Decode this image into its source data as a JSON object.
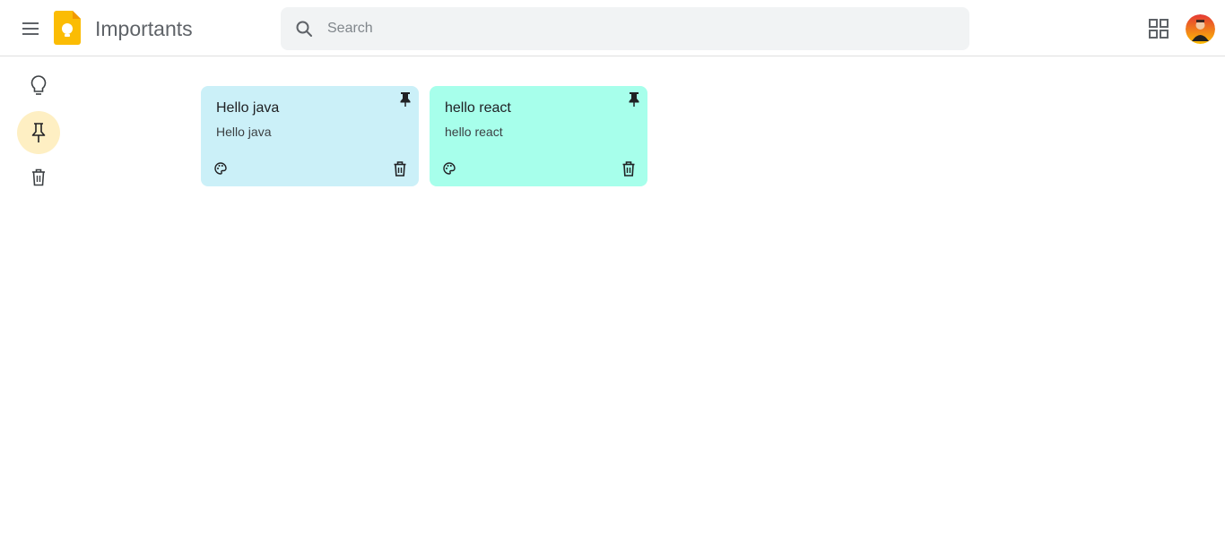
{
  "header": {
    "title": "Importants",
    "menu_icon": "hamburger-menu-icon",
    "logo_icon": "keep-logo-icon",
    "search": {
      "placeholder": "Search",
      "value": "",
      "icon": "search-icon"
    },
    "layout_icon": "grid-view-icon",
    "avatar_icon": "user-avatar"
  },
  "sidebar": {
    "items": [
      {
        "id": "notes",
        "icon": "lightbulb-icon",
        "active": false
      },
      {
        "id": "importants",
        "icon": "pin-icon",
        "active": true
      },
      {
        "id": "trash",
        "icon": "trash-icon",
        "active": false
      }
    ]
  },
  "notes": [
    {
      "title": "Hello java",
      "body": "Hello java",
      "color": "#cbf0f8",
      "pinned": true
    },
    {
      "title": "hello react",
      "body": "hello react",
      "color": "#a7ffeb",
      "pinned": true
    }
  ],
  "colors": {
    "accent": "#fbbc04",
    "active_nav_bg": "#feefc3",
    "search_bg": "#f1f3f4"
  }
}
